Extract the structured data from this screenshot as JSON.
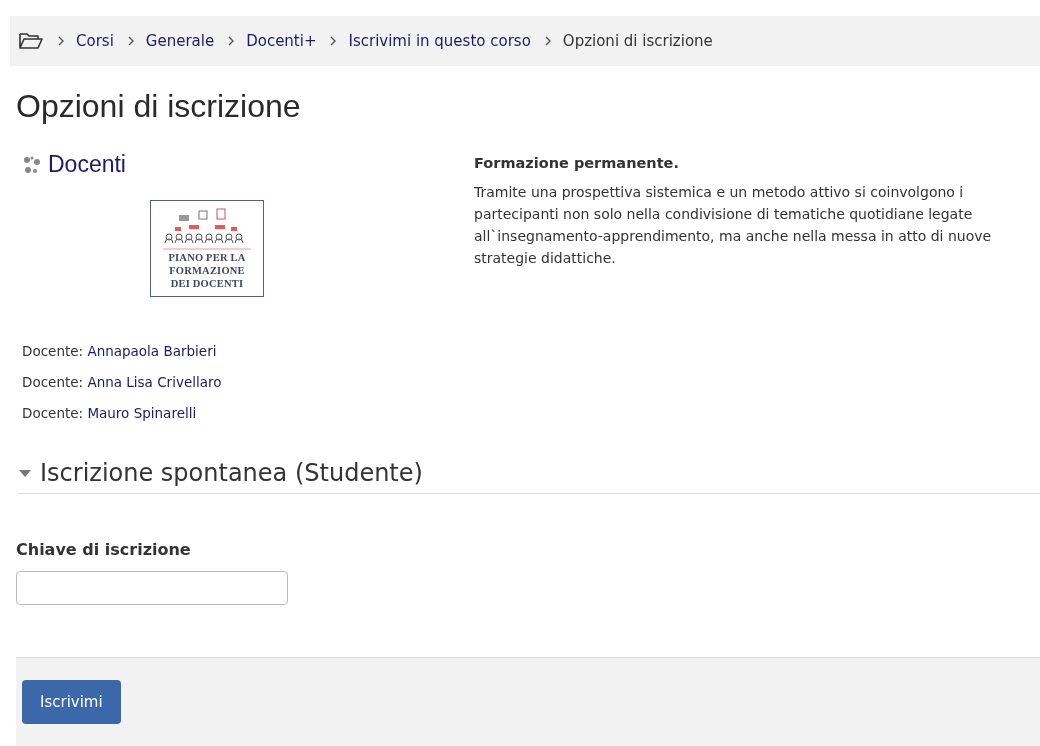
{
  "breadcrumb": [
    {
      "label": "Corsi",
      "link": true
    },
    {
      "label": "Generale",
      "link": true
    },
    {
      "label": "Docenti+",
      "link": true
    },
    {
      "label": "Iscrivimi in questo corso",
      "link": true
    },
    {
      "label": "Opzioni di iscrizione",
      "link": false
    }
  ],
  "page_title": "Opzioni di iscrizione",
  "course": {
    "name": "Docenti",
    "image_lines": [
      "PIANO PER LA",
      "FORMAZIONE",
      "DEI DOCENTI"
    ],
    "teachers": [
      {
        "role": "Docente:",
        "name": "Annapaola Barbieri"
      },
      {
        "role": "Docente:",
        "name": "Anna Lisa Crivellaro"
      },
      {
        "role": "Docente:",
        "name": "Mauro Spinarelli"
      }
    ],
    "summary_title": "Formazione permanente.",
    "summary": "Tramite una prospettiva sistemica e un metodo attivo si coinvolgono i partecipanti non solo nella condivisione di tematiche quotidiane legate all`insegnamento-apprendimento, ma anche nella messa in atto di nuove strategie didattiche."
  },
  "section": {
    "title": "Iscrizione spontanea (Studente)",
    "expanded": true
  },
  "form": {
    "label": "Chiave di iscrizione",
    "submit": "Iscrivimi"
  }
}
